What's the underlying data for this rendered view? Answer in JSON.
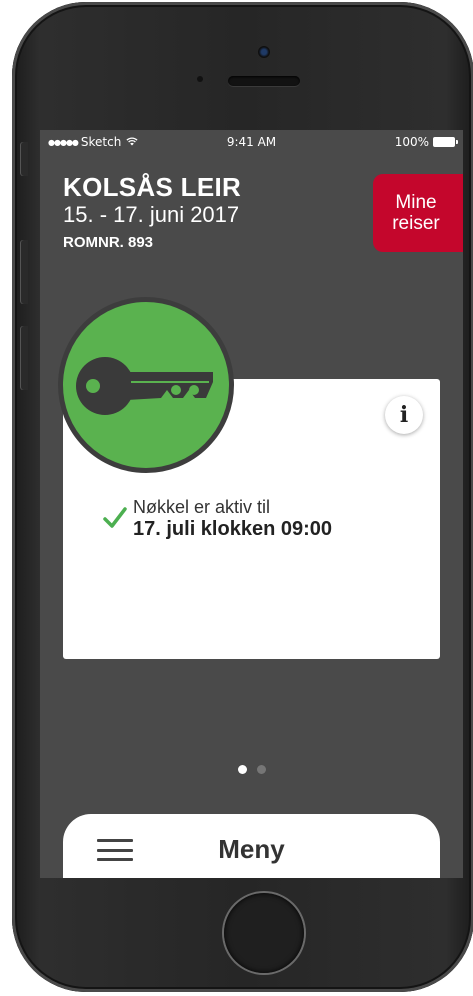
{
  "status_bar": {
    "signal": "●●●●●",
    "carrier": "Sketch",
    "wifi_icon": "wifi-icon",
    "time": "9:41 AM",
    "battery": "100%"
  },
  "trip": {
    "title": "KOLSÅS LEIR",
    "dates": "15. - 17. juni 2017",
    "room": "ROMNR. 893"
  },
  "trips_button": {
    "line1": "Mine",
    "line2": "reiser"
  },
  "key_card": {
    "icon": "key-icon",
    "info_label": "i",
    "status_line_1": "Nøkkel er aktiv til",
    "status_line_2": "17. juli klokken 09:00"
  },
  "pagination": {
    "count": 2,
    "active_index": 0
  },
  "menu": {
    "label": "Meny"
  },
  "colors": {
    "screen_background": "#4a4a4a",
    "accent_red": "#c4062c",
    "key_green": "#5ab24f",
    "check_green": "#4caf50"
  }
}
